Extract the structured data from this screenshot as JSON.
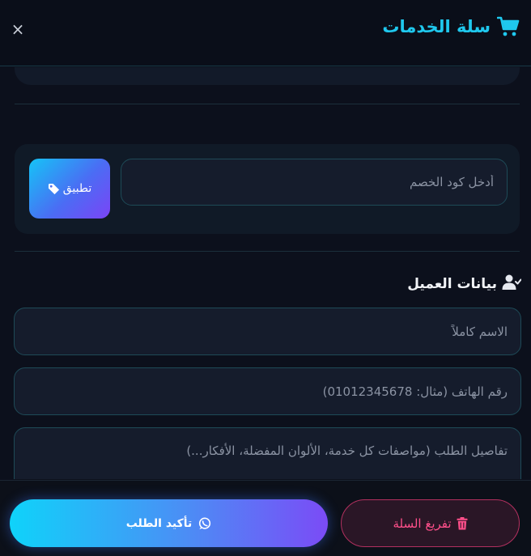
{
  "header": {
    "title": "سلة الخدمات",
    "close_symbol": "×",
    "cart_icon": "cart-icon",
    "close_icon": "close-icon"
  },
  "coupon": {
    "placeholder": "أدخل كود الخصم",
    "value": "",
    "apply_label": "تطبيق",
    "apply_icon": "tag-icon"
  },
  "customer": {
    "section_title": "بيانات العميل",
    "section_icon": "user-check-icon",
    "name_placeholder": "الاسم كاملاً",
    "name_value": "",
    "phone_placeholder": "رقم الهاتف (مثال: 01012345678)",
    "phone_value": "",
    "details_placeholder": "تفاصيل الطلب (مواصفات كل خدمة، الألوان المفضلة، الأفكار...)",
    "details_value": ""
  },
  "footer": {
    "confirm_label": "تأكيد الطلب",
    "confirm_icon": "whatsapp-icon",
    "clear_label": "تفريغ السلة",
    "clear_icon": "trash-icon"
  },
  "colors": {
    "accent": "#1fc8ee",
    "background": "#0c101c",
    "danger": "#ff4f8a",
    "gradient_start": "#0fd3fa",
    "gradient_end": "#7b4bf6"
  }
}
